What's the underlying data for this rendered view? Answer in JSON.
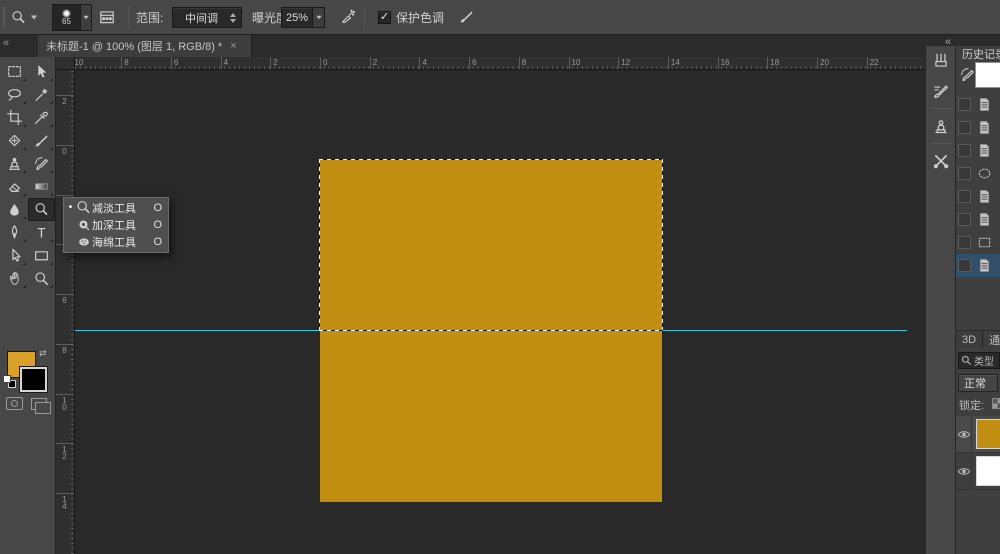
{
  "options_bar": {
    "tool": "dodge-tool",
    "brush_size": "65",
    "range_label": "范围:",
    "range_value": "中间调",
    "exposure_label": "曝光度:",
    "exposure_value": "25%",
    "protect_tones_label": "保护色调",
    "protect_tones_checked": true,
    "check_glyph": "✓"
  },
  "tab_bar": {
    "collapse_glyph": "«",
    "title": "未标题-1 @ 100% (图层 1, RGB/8) *",
    "close_glyph": "×"
  },
  "tools": {
    "items": [
      {
        "name": "rectangular-marquee-tool",
        "icon": "marquee"
      },
      {
        "name": "move-tool",
        "icon": "move"
      },
      {
        "name": "lasso-tool",
        "icon": "lasso"
      },
      {
        "name": "magic-wand-tool",
        "icon": "wand"
      },
      {
        "name": "crop-tool",
        "icon": "crop"
      },
      {
        "name": "eyedropper-tool",
        "icon": "eyedropper"
      },
      {
        "name": "healing-brush-tool",
        "icon": "healing"
      },
      {
        "name": "brush-tool",
        "icon": "brush"
      },
      {
        "name": "clone-stamp-tool",
        "icon": "stamp"
      },
      {
        "name": "history-brush-tool",
        "icon": "historybrush"
      },
      {
        "name": "eraser-tool",
        "icon": "eraser"
      },
      {
        "name": "gradient-tool",
        "icon": "gradient"
      },
      {
        "name": "blur-tool",
        "icon": "blur"
      },
      {
        "name": "dodge-tool",
        "icon": "dodge",
        "selected": true
      },
      {
        "name": "pen-tool",
        "icon": "pen"
      },
      {
        "name": "type-tool",
        "icon": "type"
      },
      {
        "name": "path-selection-tool",
        "icon": "pathsel"
      },
      {
        "name": "shape-tool",
        "icon": "shape"
      },
      {
        "name": "hand-tool",
        "icon": "hand"
      },
      {
        "name": "zoom-tool",
        "icon": "zoom"
      }
    ],
    "foreground_color": "#d9a02b",
    "background_color": "#000000"
  },
  "flyout": {
    "items": [
      {
        "label": "减淡工具",
        "shortcut": "O",
        "icon": "dodge",
        "selected": true
      },
      {
        "label": "加深工具",
        "shortcut": "O",
        "icon": "burn",
        "selected": false
      },
      {
        "label": "海绵工具",
        "shortcut": "O",
        "icon": "sponge",
        "selected": false
      }
    ],
    "bullet_glyph": "•"
  },
  "rulers": {
    "horizontal": [
      "10",
      "8",
      "6",
      "4",
      "2",
      "0",
      "2",
      "4",
      "6",
      "8",
      "10",
      "12",
      "14",
      "16",
      "18",
      "20",
      "22"
    ],
    "vertical": [
      "2",
      "0",
      "2",
      "4",
      "6",
      "8",
      "10",
      "12",
      "14"
    ]
  },
  "canvas": {
    "square_color": "#c28e12",
    "guide_color": "#41c4d2",
    "zoom_level": "100%"
  },
  "right_dock": {
    "collapse_glyph": "«",
    "buttons": [
      {
        "name": "brushes-panel",
        "icon": "brushes_panel"
      },
      {
        "name": "brush-presets-panel",
        "icon": "brush_presets"
      },
      {
        "name": "clone-source-panel",
        "icon": "clone_source"
      },
      {
        "name": "tool-presets-panel",
        "icon": "tool_presets"
      }
    ]
  },
  "history": {
    "title": "历史记录",
    "snapshot_thumb_color": "#ffffff",
    "rows": [
      {
        "icon": "doc",
        "selected": false
      },
      {
        "icon": "doc",
        "selected": false
      },
      {
        "icon": "doc",
        "selected": false
      },
      {
        "icon": "selellipse",
        "selected": false
      },
      {
        "icon": "doc",
        "selected": false
      },
      {
        "icon": "doc",
        "selected": false
      },
      {
        "icon": "selrect",
        "selected": false
      },
      {
        "icon": "doc",
        "selected": true
      }
    ]
  },
  "panels": {
    "tabs": [
      "3D",
      "通道"
    ],
    "filter_label": "类型",
    "blend_mode": "正常",
    "lock_label": "锁定:",
    "layers": [
      {
        "name": "layer-1",
        "thumb_color": "#c28e12",
        "visible": true,
        "selected": true
      },
      {
        "name": "background-layer",
        "thumb_color": "#ffffff",
        "visible": true,
        "selected": false
      }
    ]
  }
}
